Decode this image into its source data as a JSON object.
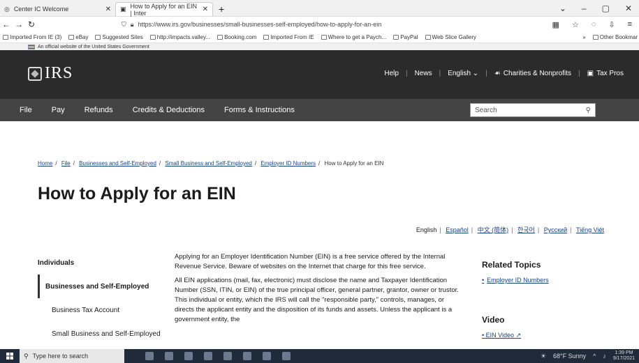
{
  "browser": {
    "tabs": [
      {
        "label": "Center IC Welcome",
        "active": false
      },
      {
        "label": "How to Apply for an EIN | Inter",
        "active": true
      }
    ],
    "url": "https://www.irs.gov/businesses/small-businesses-self-employed/how-to-apply-for-an-ein",
    "bookmarks": [
      "Imported From IE (3)",
      "eBay",
      "Suggested Sites",
      "http://impacts.valley...",
      "Booking.com",
      "Imported From IE",
      "Where to get a Paych...",
      "PayPal",
      "Web Slice Gallery"
    ],
    "bookmarks_more": "Other Bookmar",
    "gov_banner": "An official website of the United States Government"
  },
  "header": {
    "logo": "IRS",
    "util_links": [
      "Help",
      "News",
      "English",
      "Charities & Nonprofits",
      "Tax Pros"
    ],
    "nav": [
      "File",
      "Pay",
      "Refunds",
      "Credits & Deductions",
      "Forms & Instructions"
    ],
    "search_placeholder": "Search"
  },
  "breadcrumb": {
    "items": [
      "Home",
      "File",
      "Businesses and Self-Employed",
      "Small Business and Self-Employed",
      "Employer ID Numbers"
    ],
    "current": "How to Apply for an EIN"
  },
  "page_title": "How to Apply for an EIN",
  "languages": [
    "English",
    "Español",
    "中文 (简体)",
    "한국어",
    "Pусский",
    "Tiếng Việt"
  ],
  "sidenav": {
    "items": [
      {
        "label": "Individuals",
        "type": "top"
      },
      {
        "label": "Businesses and Self-Employed",
        "type": "active"
      },
      {
        "label": "Business Tax Account",
        "type": "sub"
      },
      {
        "label": "Small Business and Self-Employed",
        "type": "sub"
      }
    ]
  },
  "main": {
    "para1": "Applying for an Employer Identification Number (EIN) is a free service offered by the Internal Revenue Service. Beware of websites on the Internet that charge for this free service.",
    "para2": "All EIN applications (mail, fax, electronic) must disclose the name and Taxpayer Identification Number (SSN, ITIN, or EIN) of the true principal officer, general partner, grantor, owner or trustor. This individual or entity, which the IRS will call the \"responsible party,\" controls, manages, or directs the applicant entity and the disposition of its funds and assets. Unless the applicant is a government entity, the"
  },
  "related": {
    "title": "Related Topics",
    "link": "Employer ID Numbers"
  },
  "video": {
    "title": "Video",
    "link": "EIN Video"
  },
  "taskbar": {
    "search_placeholder": "Type here to search",
    "weather": "68°F Sunny",
    "time": "1:39 PM",
    "date": "9/17/2021"
  }
}
